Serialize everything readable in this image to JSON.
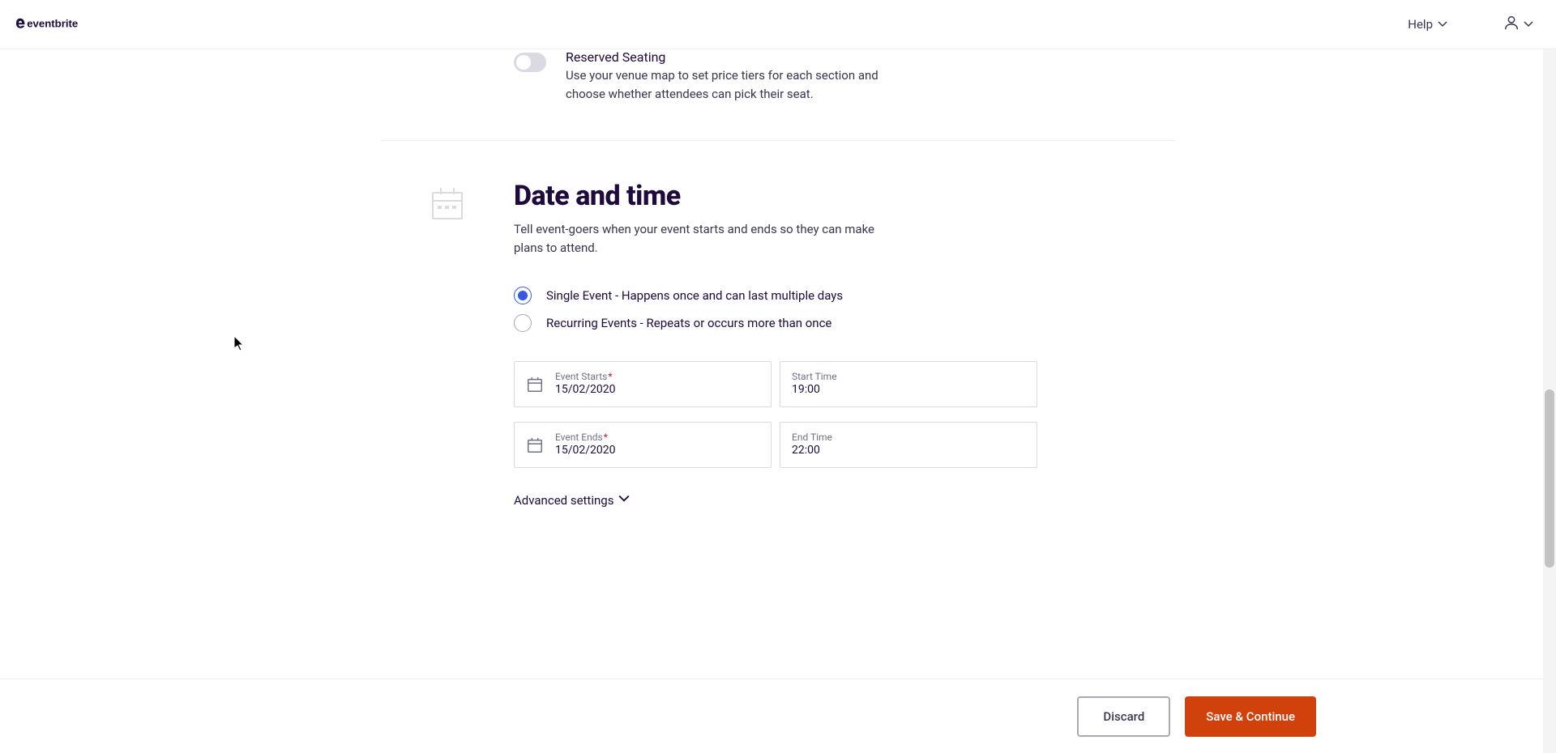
{
  "topbar": {
    "help_label": "Help"
  },
  "reserved": {
    "title": "Reserved Seating",
    "desc": "Use your venue map to set price tiers for each section and choose whether attendees can pick their seat."
  },
  "date_section": {
    "heading": "Date and time",
    "sub": "Tell event-goers when your event starts and ends so they can make plans to attend.",
    "radio_single": "Single Event - Happens once and can last multiple days",
    "radio_recurring": "Recurring Events - Repeats or occurs more than once",
    "event_starts_label": "Event Starts",
    "event_starts_value": "15/02/2020",
    "start_time_label": "Start Time",
    "start_time_value": "19:00",
    "event_ends_label": "Event Ends",
    "event_ends_value": "15/02/2020",
    "end_time_label": "End Time",
    "end_time_value": "22:00",
    "advanced_settings": "Advanced settings"
  },
  "footer": {
    "discard": "Discard",
    "save": "Save & Continue"
  },
  "colors": {
    "accent": "#d1410c",
    "link": "#3659e3"
  }
}
